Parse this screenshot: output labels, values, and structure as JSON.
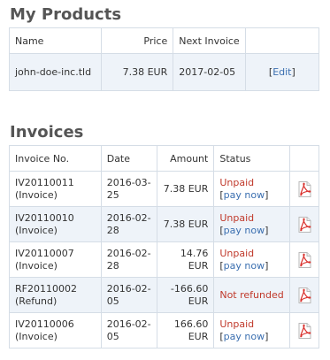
{
  "products": {
    "title": "My Products",
    "headers": {
      "name": "Name",
      "price": "Price",
      "next_invoice": "Next Invoice"
    },
    "rows": [
      {
        "name": "john-doe-inc.tld",
        "price": "7.38 EUR",
        "next_invoice": "2017-02-05",
        "edit_label": "Edit"
      }
    ]
  },
  "invoices": {
    "title": "Invoices",
    "headers": {
      "number": "Invoice No.",
      "date": "Date",
      "amount": "Amount",
      "status": "Status"
    },
    "rows": [
      {
        "number": "IV20110011 (Invoice)",
        "date": "2016-03-25",
        "amount": "7.38 EUR",
        "status": "Unpaid",
        "action": "pay now"
      },
      {
        "number": "IV20110010 (Invoice)",
        "date": "2016-02-28",
        "amount": "7.38 EUR",
        "status": "Unpaid",
        "action": "pay now"
      },
      {
        "number": "IV20110007 (Invoice)",
        "date": "2016-02-28",
        "amount": "14.76 EUR",
        "status": "Unpaid",
        "action": "pay now"
      },
      {
        "number": "RF20110002 (Refund)",
        "date": "2016-02-05",
        "amount": "-166.60 EUR",
        "status": "Not refunded",
        "action": ""
      },
      {
        "number": "IV20110006 (Invoice)",
        "date": "2016-02-05",
        "amount": "166.60 EUR",
        "status": "Unpaid",
        "action": "pay now"
      }
    ]
  },
  "colors": {
    "title": "#555555",
    "border": "#d5dde6",
    "row_alt": "#eef3f9",
    "status": "#c0392b",
    "link": "#3b6fb0",
    "pdf": "#d9302c"
  },
  "icons": {
    "invoice_download": "pdf-icon"
  }
}
